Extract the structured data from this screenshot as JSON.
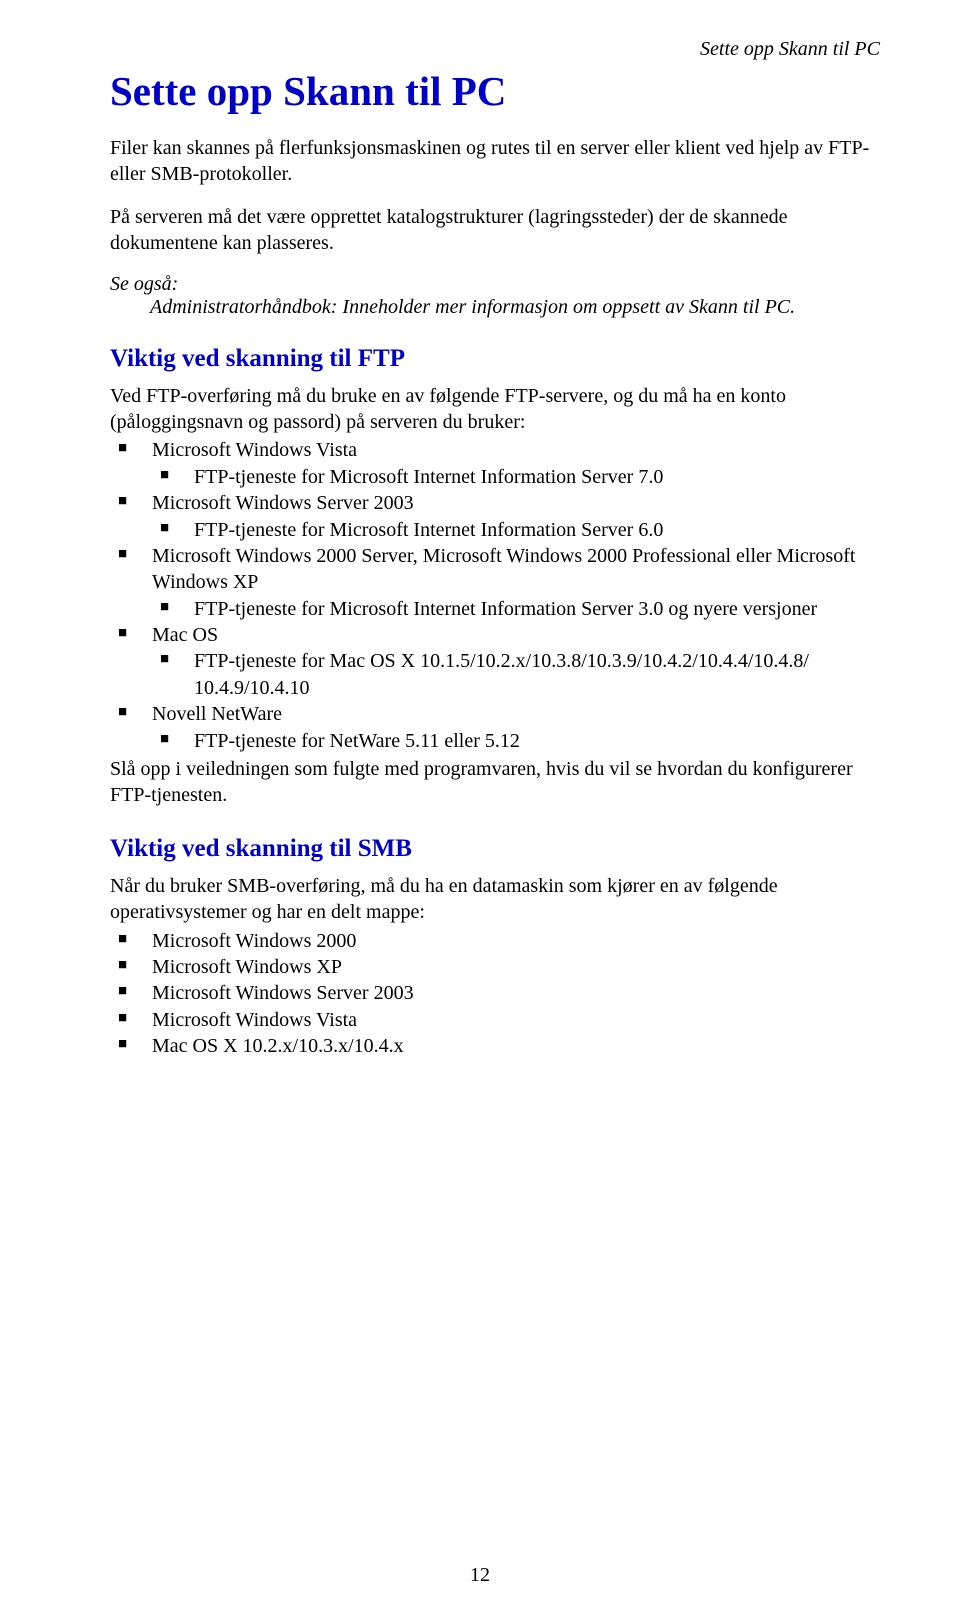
{
  "runningHeader": "Sette opp Skann til PC",
  "title": "Sette opp Skann til PC",
  "intro1": "Filer kan skannes på flerfunksjonsmaskinen og rutes til en server eller klient ved hjelp av FTP- eller SMB-protokoller.",
  "intro2": "På serveren må det være opprettet katalogstrukturer (lagringssteder) der de skannede dokumentene kan plasseres.",
  "seeAlso": {
    "label": "Se også:",
    "ref": "Administratorhåndbok: Inneholder mer informasjon om oppsett av Skann til PC."
  },
  "ftp": {
    "heading": "Viktig ved skanning til FTP",
    "lead": "Ved FTP-overføring må du bruke en av følgende FTP-servere, og du må ha en konto (påloggingsnavn og passord) på serveren du bruker:",
    "items": [
      {
        "label": "Microsoft Windows Vista",
        "sub": [
          "FTP-tjeneste for Microsoft Internet Information Server 7.0"
        ]
      },
      {
        "label": "Microsoft Windows Server 2003",
        "sub": [
          "FTP-tjeneste for Microsoft Internet Information Server 6.0"
        ]
      },
      {
        "label": "Microsoft Windows 2000 Server, Microsoft Windows 2000 Professional eller Microsoft Windows XP",
        "sub": [
          "FTP-tjeneste for Microsoft Internet Information Server 3.0 og nyere versjoner"
        ]
      },
      {
        "label": "Mac OS",
        "sub": [
          "FTP-tjeneste for Mac OS X 10.1.5/10.2.x/10.3.8/10.3.9/10.4.2/10.4.4/10.4.8/ 10.4.9/10.4.10"
        ]
      },
      {
        "label": "Novell NetWare",
        "sub": [
          "FTP-tjeneste for NetWare 5.11 eller 5.12"
        ]
      }
    ],
    "tail": "Slå opp i veiledningen som fulgte med programvaren, hvis du vil se hvordan du konfigurerer FTP-tjenesten."
  },
  "smb": {
    "heading": "Viktig ved skanning til SMB",
    "lead": "Når du bruker SMB-overføring, må du ha en datamaskin som kjører en av følgende operativsystemer og har en delt mappe:",
    "items": [
      "Microsoft Windows 2000",
      "Microsoft Windows XP",
      "Microsoft Windows Server 2003",
      "Microsoft Windows Vista",
      "Mac OS X 10.2.x/10.3.x/10.4.x"
    ]
  },
  "pageNumber": "12"
}
